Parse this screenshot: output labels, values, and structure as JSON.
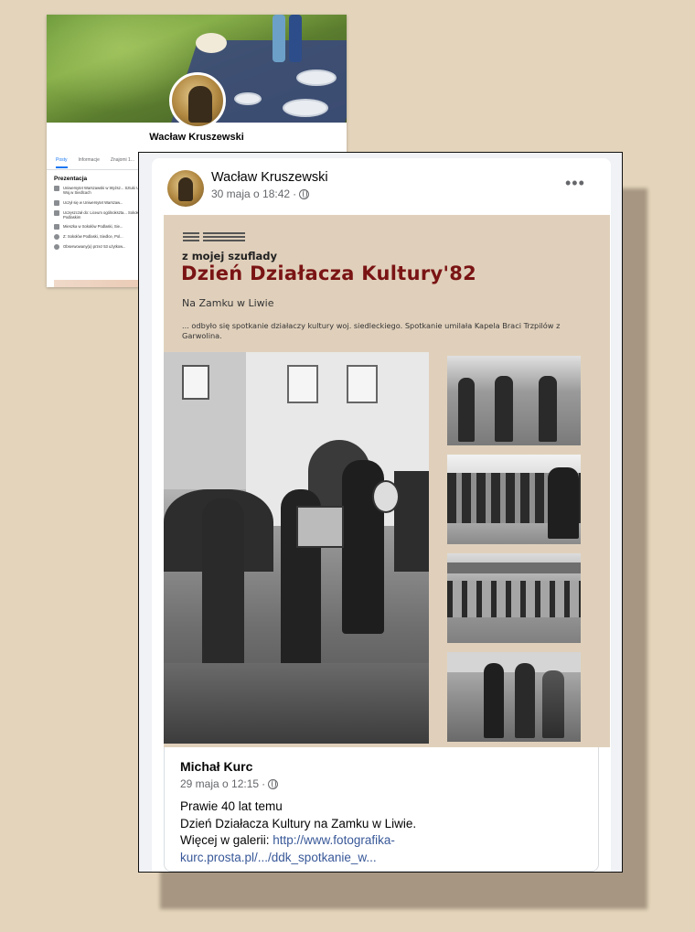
{
  "profile_card": {
    "name": "Wacław Kruszewski",
    "tabs": [
      "Posty",
      "Informacje",
      "Znajomi 1..."
    ],
    "intro_title": "Prezentacja",
    "intro_items": [
      {
        "icon": "briefcase-icon",
        "text": "Uniwersytet Warszawski w Wyższ... Sztuki Urzędu Woj.w Siedlcach"
      },
      {
        "icon": "graduation-cap-icon",
        "text": "Uczył się w Uniwersytet Warszaw..."
      },
      {
        "icon": "graduation-cap-icon",
        "text": "Uczęszczał do: Liceum ogólnokszta... Sokołowie Podlaskim"
      },
      {
        "icon": "home-icon",
        "text": "Mieszka w Sokołów Podlaski, Sie..."
      },
      {
        "icon": "location-pin-icon",
        "text": "Z: Sokołów Podlaski, Siedlce, Pol..."
      },
      {
        "icon": "rss-icon",
        "text": "Obserwowany(a) przez 53 użytkow..."
      }
    ]
  },
  "post": {
    "author": "Wacław Kruszewski",
    "timestamp": "30 maja o 18:42",
    "separator": "·",
    "more_label": "•••",
    "poster": {
      "kicker": "z mojej szuflady",
      "title": "Dzień Działacza Kultury'82",
      "subtitle": "Na Zamku w Liwie",
      "description": "... odbyło się spotkanie działaczy kultury woj. siedleckiego. Spotkanie umilała Kapela Braci Trzpilów z Garwolina."
    },
    "shared": {
      "author": "Michał Kurc",
      "timestamp": "29 maja o 12:15",
      "separator": "·",
      "line1": "Prawie 40 lat temu",
      "line2": "Dzień Działacza Kultury na Zamku w Liwie.",
      "line3_prefix": "Więcej w galerii: ",
      "link_text": "http://www.fotografika-kurc.prosta.pl/.../ddk_spotkanie_w..."
    }
  }
}
